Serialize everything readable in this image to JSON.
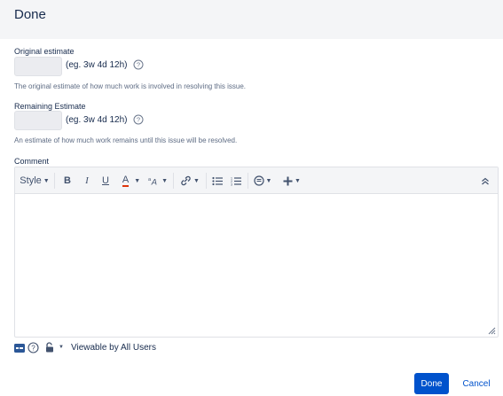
{
  "dialog": {
    "title": "Done"
  },
  "original_estimate": {
    "label": "Original estimate",
    "value": "",
    "hint": "(eg. 3w 4d 12h)",
    "description": "The original estimate of how much work is involved in resolving this issue."
  },
  "remaining_estimate": {
    "label": "Remaining Estimate",
    "value": "",
    "hint": "(eg. 3w 4d 12h)",
    "description": "An estimate of how much work remains until this issue will be resolved."
  },
  "comment": {
    "label": "Comment",
    "value": "",
    "toolbar": {
      "style_label": "Style",
      "bold_label": "B",
      "italic_label": "I",
      "underline_label": "U",
      "text_color_label": "A",
      "text_color_accent": "#de350b",
      "icons": [
        "text-style-icon",
        "bold-icon",
        "italic-icon",
        "underline-icon",
        "text-color-icon",
        "text-effects-icon",
        "link-icon",
        "bullet-list-icon",
        "numbered-list-icon",
        "emoticon-icon",
        "insert-more-icon",
        "collapse-toolbar-icon"
      ]
    }
  },
  "footer": {
    "visibility_text": "Viewable by All Users",
    "icons": [
      "editor-mode-icon",
      "help-icon",
      "lock-icon",
      "dropdown-icon"
    ]
  },
  "actions": {
    "done_label": "Done",
    "cancel_label": "Cancel"
  },
  "colors": {
    "primary": "#0052cc",
    "header_bg": "#f4f5f7",
    "text": "#172b4d",
    "muted_text": "#5e6c84"
  }
}
